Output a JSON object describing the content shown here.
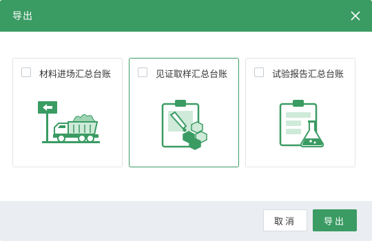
{
  "dialog": {
    "title": "导出",
    "close_icon": "close-icon"
  },
  "options": [
    {
      "label": "材料进场汇总台账",
      "icon": "truck-sign-icon",
      "checked": false,
      "selected": false
    },
    {
      "label": "见证取样汇总台账",
      "icon": "clipboard-dropper-cubes-icon",
      "checked": false,
      "selected": true
    },
    {
      "label": "试验报告汇总台账",
      "icon": "clipboard-flask-icon",
      "checked": false,
      "selected": false
    }
  ],
  "footer": {
    "cancel_label": "取消",
    "confirm_label": "导出"
  },
  "colors": {
    "brand_green": "#3a9b63",
    "light_green": "#cfead9",
    "footer_bg": "#eaedf1"
  }
}
